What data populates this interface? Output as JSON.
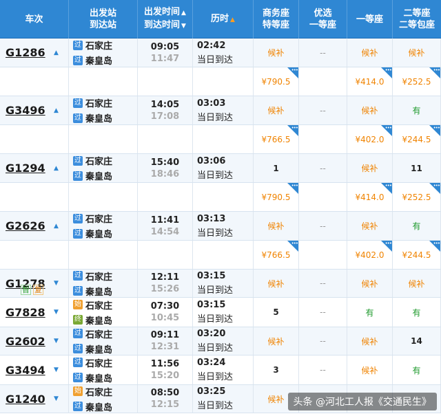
{
  "header": {
    "train": "车次",
    "station_l1": "出发站",
    "station_l2": "到达站",
    "time_l1": "出发时间",
    "time_l2": "到达时间",
    "duration": "历时",
    "biz_l1": "商务座",
    "biz_l2": "特等座",
    "prem_l1": "优选",
    "prem_l2": "一等座",
    "first": "一等座",
    "second_l1": "二等座",
    "second_l2": "二等包座"
  },
  "colors": {
    "header_bg": "#2f87d3",
    "waitlist": "#f08300",
    "available": "#1e9a2c"
  },
  "trains": [
    {
      "no": "G1286",
      "dir": "up",
      "from_tag": "过",
      "to_tag": "过",
      "from": "石家庄",
      "to": "秦皇岛",
      "dep": "09:05",
      "arr": "11:47",
      "dur": "02:42",
      "day": "当日到达",
      "biz": "候补",
      "prem": "--",
      "first": "候补",
      "second": "候补",
      "prices": {
        "biz": "¥790.5",
        "first": "¥414.0",
        "second": "¥252.5"
      }
    },
    {
      "no": "G3496",
      "dir": "up",
      "from_tag": "过",
      "to_tag": "过",
      "from": "石家庄",
      "to": "秦皇岛",
      "dep": "14:05",
      "arr": "17:08",
      "dur": "03:03",
      "day": "当日到达",
      "biz": "候补",
      "prem": "--",
      "first": "候补",
      "second": "有",
      "prices": {
        "biz": "¥766.5",
        "first": "¥402.0",
        "second": "¥244.5"
      }
    },
    {
      "no": "G1294",
      "dir": "up",
      "from_tag": "过",
      "to_tag": "过",
      "from": "石家庄",
      "to": "秦皇岛",
      "dep": "15:40",
      "arr": "18:46",
      "dur": "03:06",
      "day": "当日到达",
      "biz": "1",
      "prem": "--",
      "first": "候补",
      "second": "11",
      "prices": {
        "biz": "¥790.5",
        "first": "¥414.0",
        "second": "¥252.5"
      }
    },
    {
      "no": "G2626",
      "dir": "up",
      "from_tag": "过",
      "to_tag": "过",
      "from": "石家庄",
      "to": "秦皇岛",
      "dep": "11:41",
      "arr": "14:54",
      "dur": "03:13",
      "day": "当日到达",
      "biz": "候补",
      "prem": "--",
      "first": "候补",
      "second": "有",
      "prices": {
        "biz": "¥766.5",
        "first": "¥402.0",
        "second": "¥244.5"
      }
    },
    {
      "no": "G1278",
      "dir": "down",
      "tags": [
        "智",
        "复"
      ],
      "from_tag": "过",
      "to_tag": "过",
      "from": "石家庄",
      "to": "秦皇岛",
      "dep": "12:11",
      "arr": "15:26",
      "dur": "03:15",
      "day": "当日到达",
      "biz": "候补",
      "prem": "--",
      "first": "候补",
      "second": "候补"
    },
    {
      "no": "G7828",
      "dir": "down",
      "from_tag": "始",
      "to_tag": "终",
      "from": "石家庄",
      "to": "秦皇岛",
      "dep": "07:30",
      "arr": "10:45",
      "dur": "03:15",
      "day": "当日到达",
      "biz": "5",
      "prem": "--",
      "first": "有",
      "second": "有"
    },
    {
      "no": "G2602",
      "dir": "down",
      "from_tag": "过",
      "to_tag": "过",
      "from": "石家庄",
      "to": "秦皇岛",
      "dep": "09:11",
      "arr": "12:31",
      "dur": "03:20",
      "day": "当日到达",
      "biz": "候补",
      "prem": "--",
      "first": "候补",
      "second": "14"
    },
    {
      "no": "G3494",
      "dir": "down",
      "from_tag": "过",
      "to_tag": "过",
      "from": "石家庄",
      "to": "秦皇岛",
      "dep": "11:56",
      "arr": "15:20",
      "dur": "03:24",
      "day": "当日到达",
      "biz": "3",
      "prem": "--",
      "first": "候补",
      "second": "有"
    },
    {
      "no": "G1240",
      "dir": "down",
      "from_tag": "始",
      "to_tag": "过",
      "from": "石家庄",
      "to": "秦皇岛",
      "dep": "08:50",
      "arr": "12:15",
      "dur": "03:25",
      "day": "当日到达",
      "biz": "候补",
      "prem": "--",
      "first": "",
      "second": ""
    }
  ],
  "watermark": "头条 @河北工人报《交通民生》"
}
